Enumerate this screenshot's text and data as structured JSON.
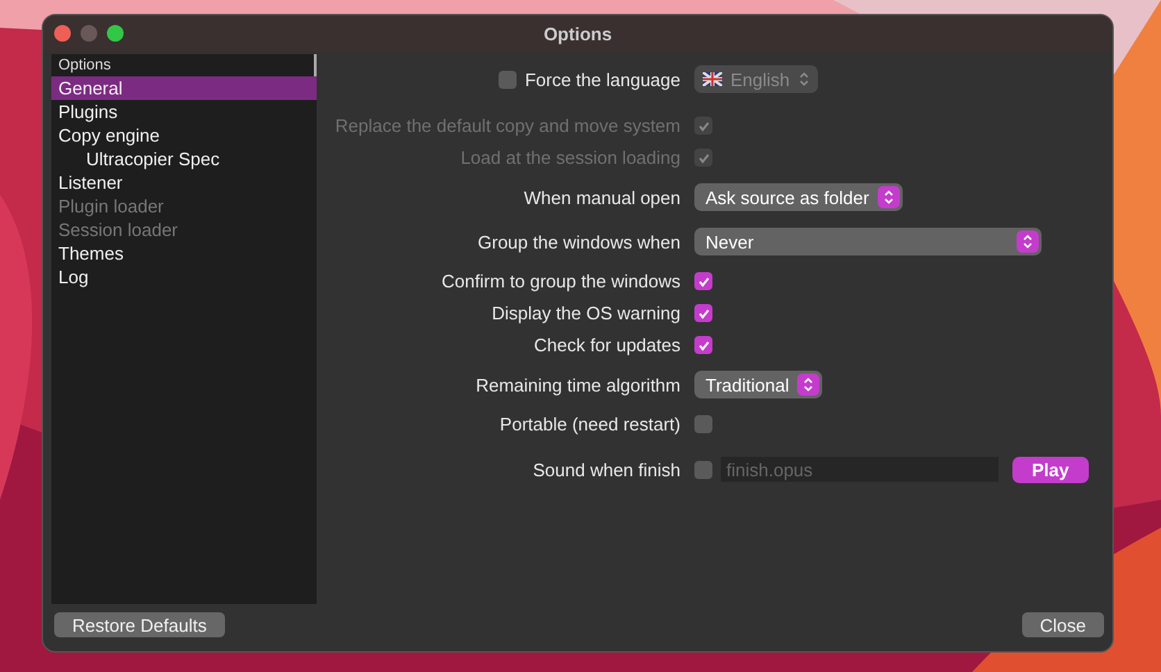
{
  "window": {
    "title": "Options"
  },
  "sidebar": {
    "header": "Options",
    "items": [
      {
        "label": "General",
        "selected": true,
        "disabled": false
      },
      {
        "label": "Plugins",
        "selected": false,
        "disabled": false
      },
      {
        "label": "Copy engine",
        "selected": false,
        "disabled": false,
        "children": [
          {
            "label": "Ultracopier Spec",
            "selected": false,
            "disabled": false
          }
        ]
      },
      {
        "label": "Listener",
        "selected": false,
        "disabled": false
      },
      {
        "label": "Plugin loader",
        "selected": false,
        "disabled": true
      },
      {
        "label": "Session loader",
        "selected": false,
        "disabled": true
      },
      {
        "label": "Themes",
        "selected": false,
        "disabled": false
      },
      {
        "label": "Log",
        "selected": false,
        "disabled": false
      }
    ]
  },
  "settings": [
    {
      "kind": "language",
      "label": "Force the language",
      "checked": false,
      "value": "English",
      "disabled": true
    },
    {
      "kind": "checkbox",
      "label": "Replace the default copy and move system",
      "checked": true,
      "disabled": true
    },
    {
      "kind": "checkbox",
      "label": "Load at the session loading",
      "checked": true,
      "disabled": true
    },
    {
      "kind": "select",
      "label": "When manual open",
      "value": "Ask source as folder"
    },
    {
      "kind": "select-wide",
      "label": "Group the windows when",
      "value": "Never"
    },
    {
      "kind": "checkbox",
      "label": "Confirm to group the windows",
      "checked": true,
      "disabled": false
    },
    {
      "kind": "checkbox",
      "label": "Display the OS warning",
      "checked": true,
      "disabled": false
    },
    {
      "kind": "checkbox",
      "label": "Check for updates",
      "checked": true,
      "disabled": false
    },
    {
      "kind": "select",
      "label": "Remaining time algorithm",
      "value": "Traditional"
    },
    {
      "kind": "checkbox",
      "label": "Portable (need restart)",
      "checked": false,
      "disabled": false
    },
    {
      "kind": "sound",
      "label": "Sound when finish",
      "checked": false,
      "placeholder": "finish.opus",
      "button": "Play"
    }
  ],
  "buttons": {
    "left": "Restore Defaults",
    "right": "Close"
  }
}
